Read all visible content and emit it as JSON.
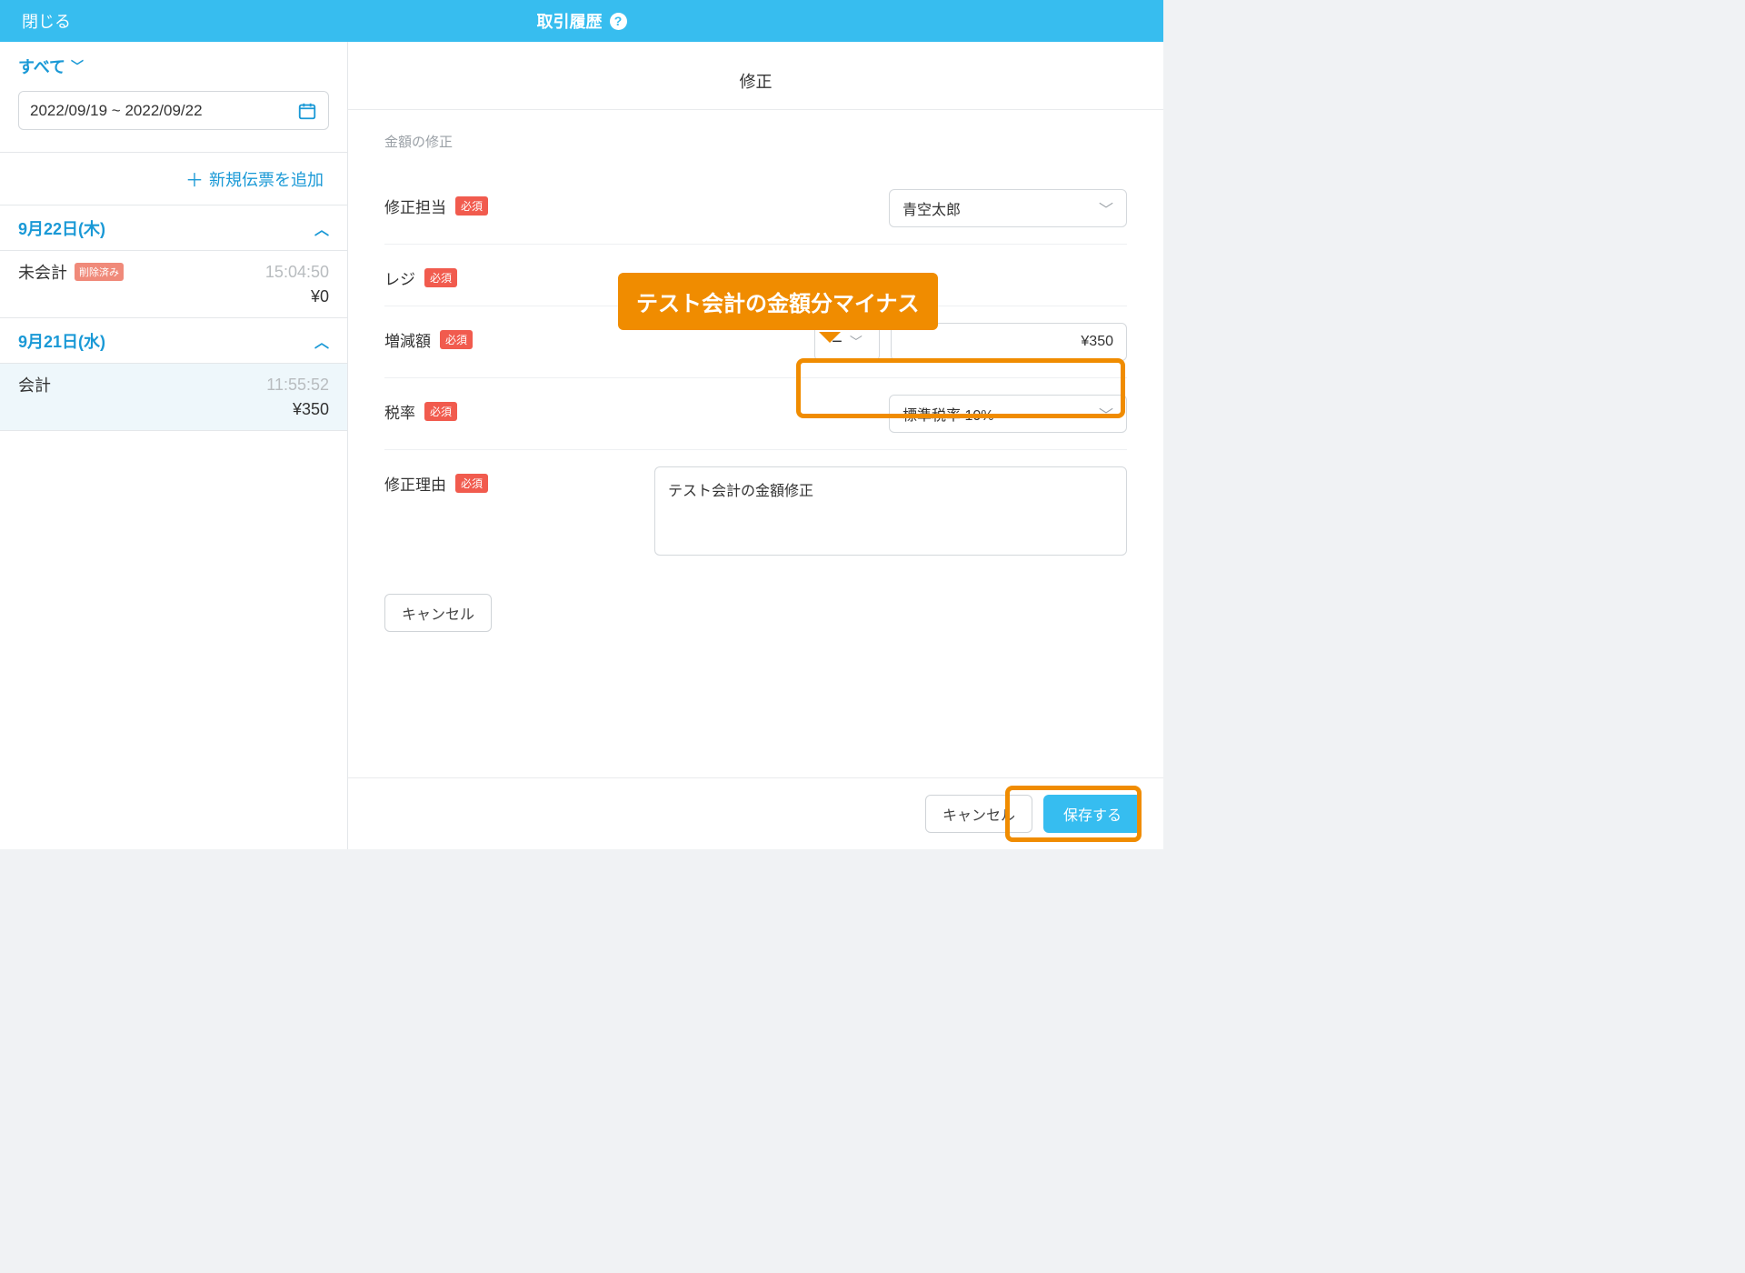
{
  "topbar": {
    "close": "閉じる",
    "title": "取引履歴"
  },
  "sidebar": {
    "filter_label": "すべて",
    "date_range": "2022/09/19 ~ 2022/09/22",
    "add_slip": "新規伝票を追加",
    "groups": [
      {
        "date": "9月22日(木)",
        "entries": [
          {
            "status": "未会計",
            "deleted_badge": "削除済み",
            "time": "15:04:50",
            "amount": "¥0"
          }
        ]
      },
      {
        "date": "9月21日(水)",
        "entries": [
          {
            "status": "会計",
            "time": "11:55:52",
            "amount": "¥350"
          }
        ]
      }
    ]
  },
  "panel": {
    "title": "修正",
    "section": "金額の修正",
    "rows": {
      "assignee": {
        "label": "修正担当",
        "req": "必須",
        "value": "青空太郎"
      },
      "register": {
        "label": "レジ",
        "req": "必須"
      },
      "amount": {
        "label": "増減額",
        "req": "必須",
        "sign": "−",
        "value": "¥350"
      },
      "tax": {
        "label": "税率",
        "req": "必須",
        "value": "標準税率 10%"
      },
      "reason": {
        "label": "修正理由",
        "req": "必須",
        "value": "テスト会計の金額修正"
      }
    },
    "inline_cancel": "キャンセル",
    "footer": {
      "cancel": "キャンセル",
      "save": "保存する"
    }
  },
  "callout": "テスト会計の金額分マイナス"
}
